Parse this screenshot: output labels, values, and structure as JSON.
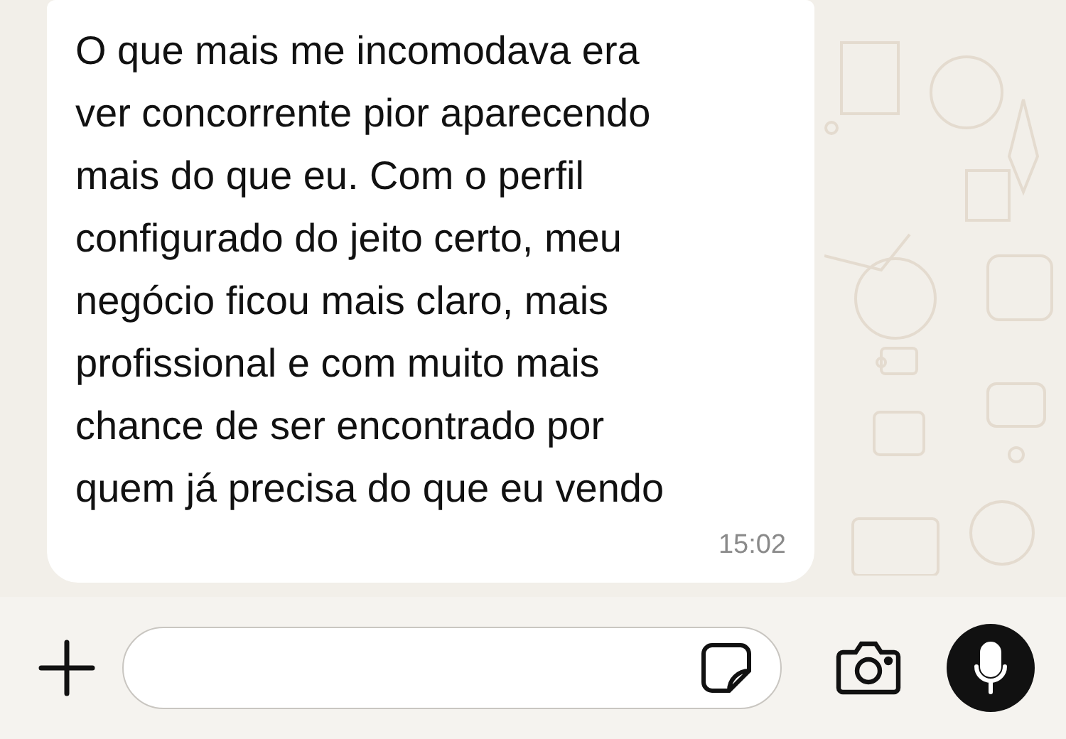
{
  "message": {
    "text": "O que mais me incomodava era\nver concorrente pior aparecendo\nmais do que eu. Com o perfil\nconfigurado do jeito certo, meu\nnegócio ficou mais claro, mais\nprofissional e com muito mais\nchance de ser encontrado por\nquem já precisa do que eu vendo",
    "time": "15:02"
  }
}
